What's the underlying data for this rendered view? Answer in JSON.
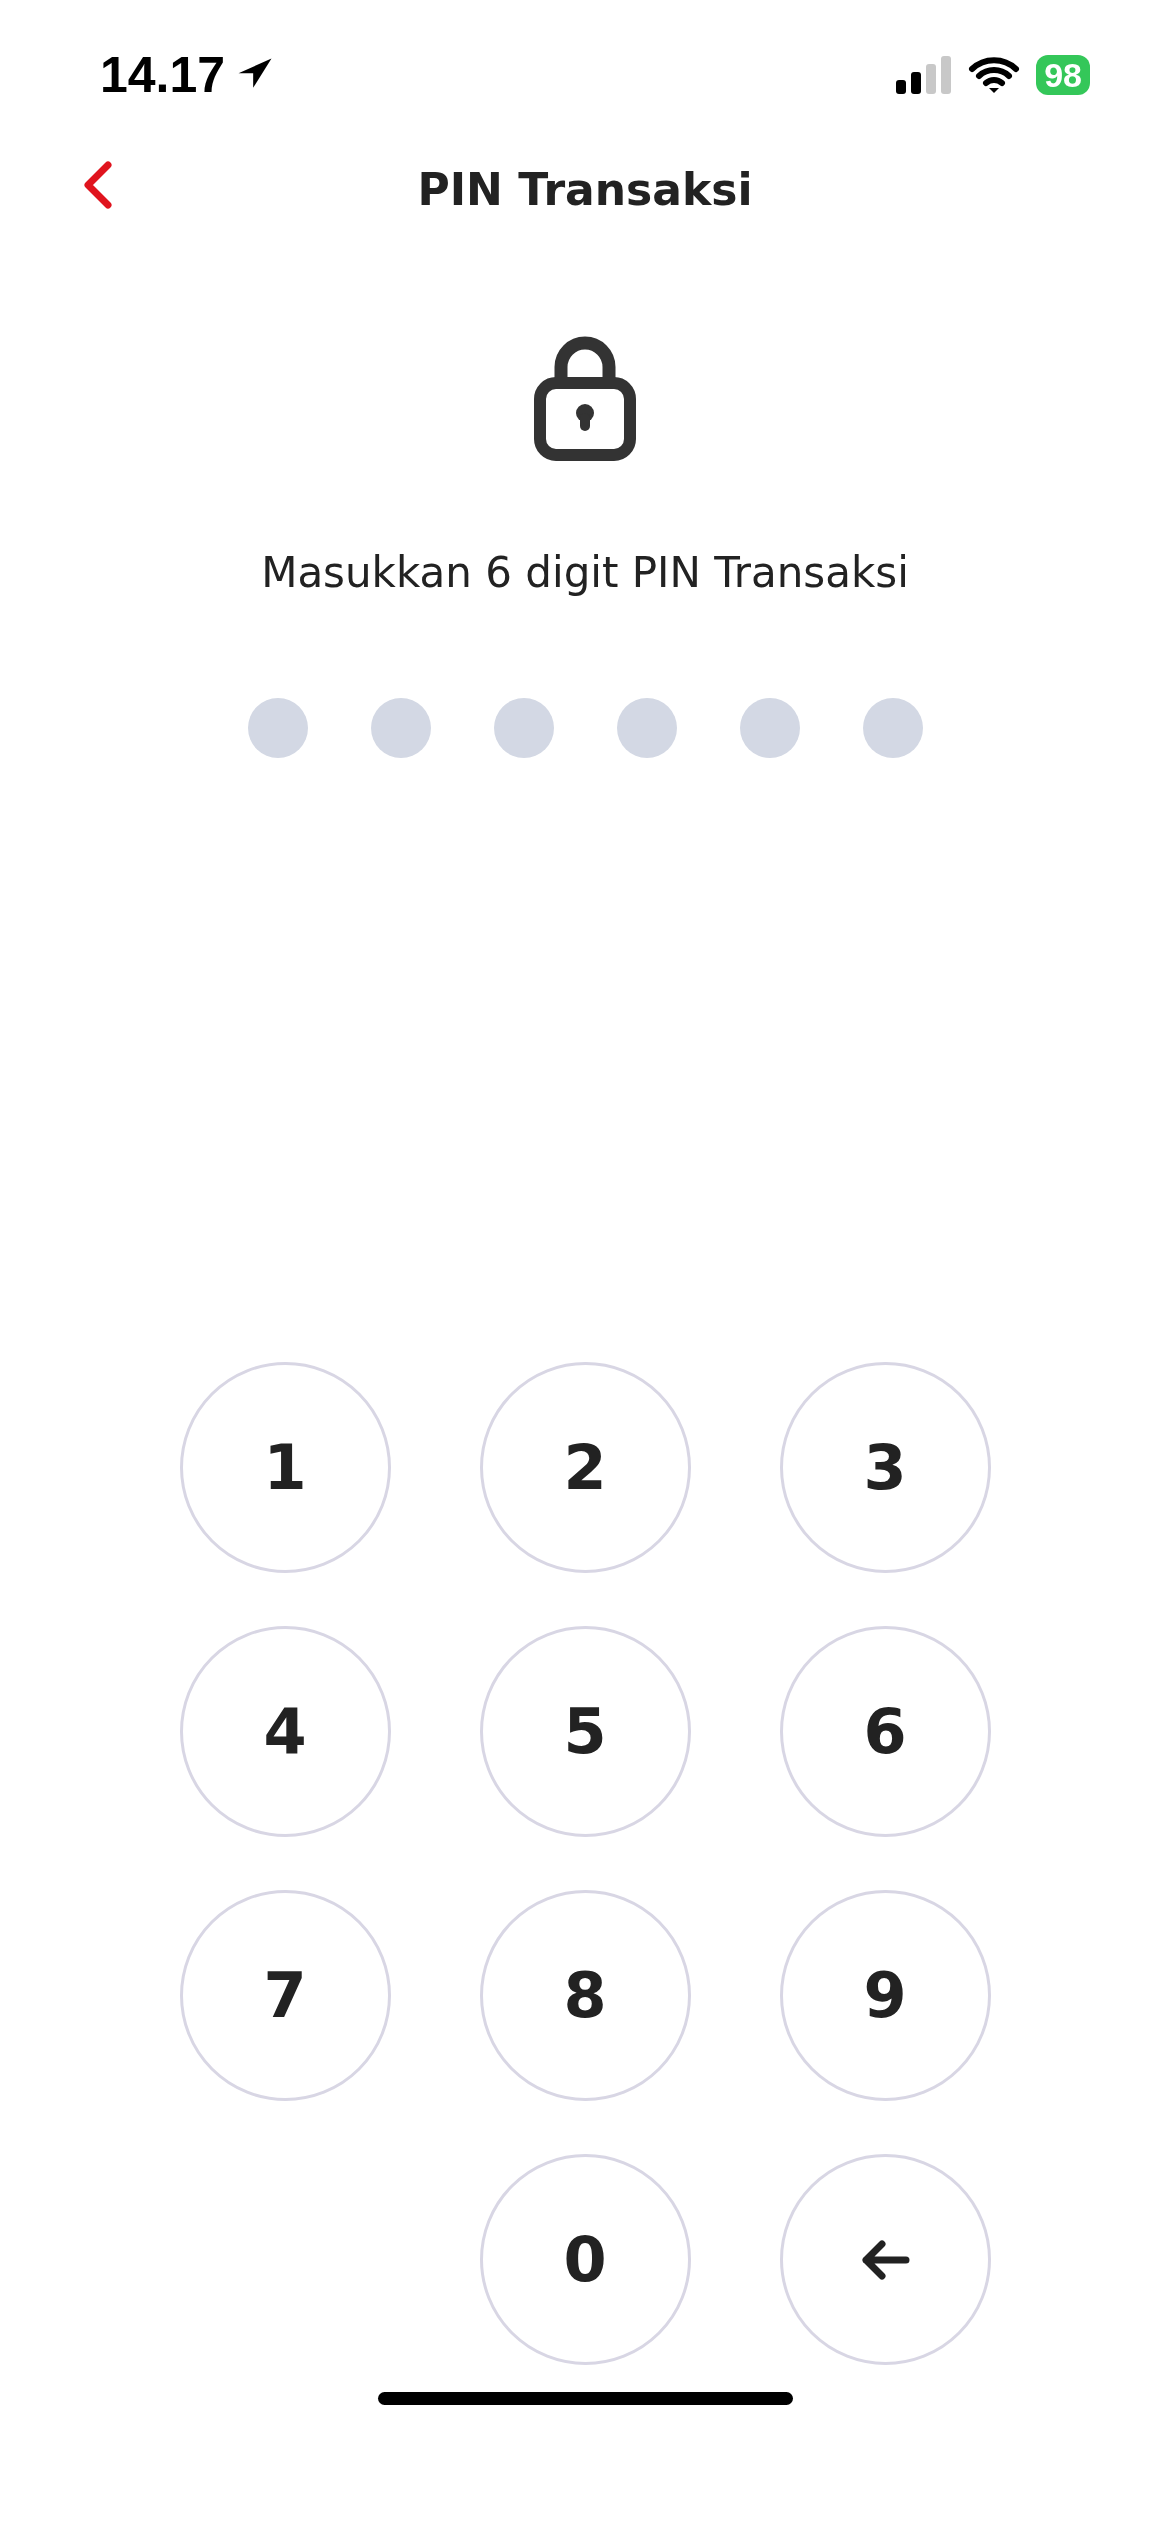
{
  "status_bar": {
    "time": "14.17",
    "battery": "98"
  },
  "header": {
    "title": "PIN Transaksi"
  },
  "prompt": "Masukkan 6 digit PIN Transaksi",
  "pin_dots": [
    {
      "filled": false
    },
    {
      "filled": false
    },
    {
      "filled": false
    },
    {
      "filled": false
    },
    {
      "filled": false
    },
    {
      "filled": false
    }
  ],
  "keypad": [
    {
      "kind": "digit",
      "label": "1"
    },
    {
      "kind": "digit",
      "label": "2"
    },
    {
      "kind": "digit",
      "label": "3"
    },
    {
      "kind": "digit",
      "label": "4"
    },
    {
      "kind": "digit",
      "label": "5"
    },
    {
      "kind": "digit",
      "label": "6"
    },
    {
      "kind": "digit",
      "label": "7"
    },
    {
      "kind": "digit",
      "label": "8"
    },
    {
      "kind": "digit",
      "label": "9"
    },
    {
      "kind": "digit",
      "label": "0"
    },
    {
      "kind": "backspace"
    }
  ]
}
